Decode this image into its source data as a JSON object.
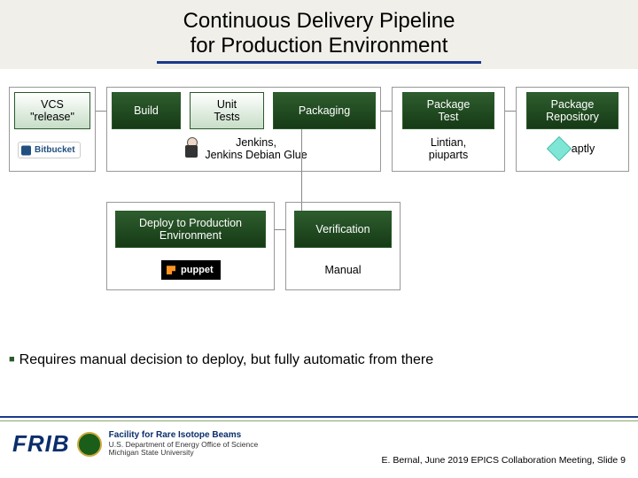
{
  "title_line1": "Continuous Delivery Pipeline",
  "title_line2": "for Production Environment",
  "stages": {
    "vcs": "VCS\n\"release\"",
    "build": "Build",
    "unit": "Unit\nTests",
    "packaging": "Packaging",
    "pkgtest": "Package\nTest",
    "pkgrepo": "Package\nRepository",
    "deploy": "Deploy to Production\nEnvironment",
    "verify": "Verification"
  },
  "tools": {
    "bitbucket": "Bitbucket",
    "jenkins": "Jenkins,\nJenkins Debian Glue",
    "lintian": "Lintian,\npiuparts",
    "aptly": "aptly",
    "puppet": "puppet",
    "manual": "Manual"
  },
  "bullet": "Requires manual decision to deploy, but fully automatic from there",
  "footer": {
    "mark": "FRIB",
    "facility": "Facility for Rare Isotope Beams",
    "dept": "U.S. Department of Energy Office of Science",
    "univ": "Michigan State University",
    "slideinfo": "E. Bernal, June 2019 EPICS Collaboration Meeting, Slide 9"
  }
}
